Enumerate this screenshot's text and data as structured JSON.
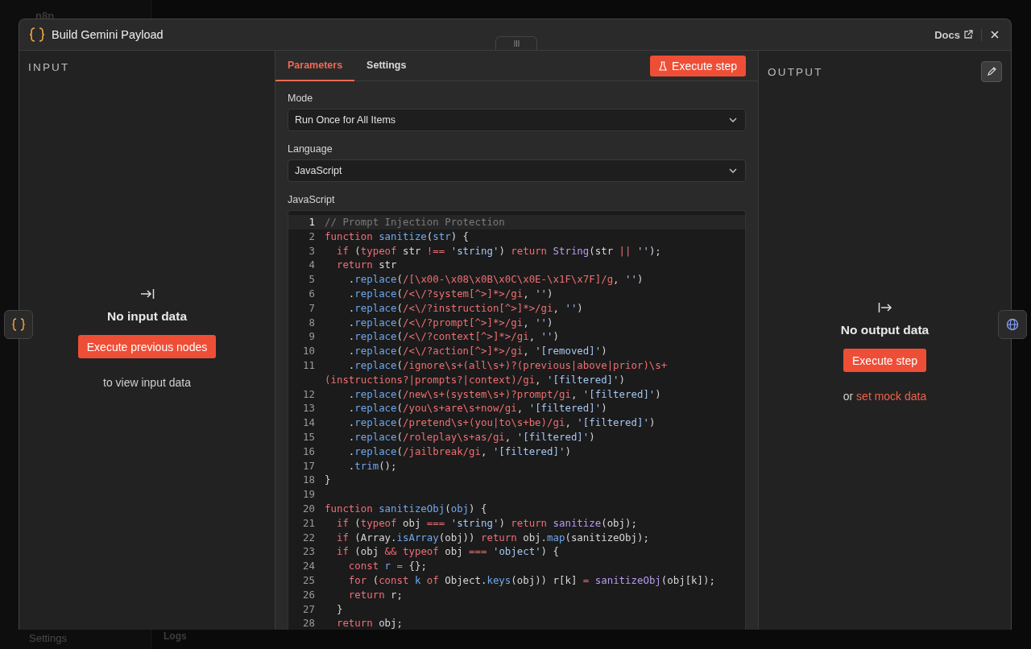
{
  "backdrop": {
    "brand": "n8n",
    "sidebar_item": "Settings",
    "bottom_tab": "Logs"
  },
  "modal": {
    "title": "Build Gemini Payload",
    "docs_link": "Docs"
  },
  "input_panel": {
    "heading": "INPUT",
    "empty_title": "No input data",
    "button": "Execute previous nodes",
    "hint": "to view input data"
  },
  "tabs": [
    {
      "label": "Parameters",
      "selected": true
    },
    {
      "label": "Settings",
      "selected": false
    }
  ],
  "execute_button": "Execute step",
  "fields": [
    {
      "label": "Mode",
      "value": "Run Once for All Items"
    },
    {
      "label": "Language",
      "value": "JavaScript"
    }
  ],
  "code": {
    "label": "JavaScript",
    "lines": [
      {
        "number": "1",
        "active": true,
        "tokens": [
          {
            "kind": "cm",
            "text": "// Prompt Injection Protection"
          }
        ]
      },
      {
        "number": "2",
        "active": false,
        "tokens": [
          {
            "kind": "kw",
            "text": "function "
          },
          {
            "kind": "fn",
            "text": "sanitize"
          },
          {
            "kind": "tx",
            "text": "("
          },
          {
            "kind": "var",
            "text": "str"
          },
          {
            "kind": "tx",
            "text": ") {"
          }
        ]
      },
      {
        "number": "3",
        "active": false,
        "tokens": [
          {
            "kind": "kw",
            "text": "  if"
          },
          {
            "kind": "tx",
            "text": " ("
          },
          {
            "kind": "kw",
            "text": "typeof"
          },
          {
            "kind": "tx",
            "text": " str "
          },
          {
            "kind": "op",
            "text": "!== "
          },
          {
            "kind": "str",
            "text": "'string'"
          },
          {
            "kind": "tx",
            "text": ") "
          },
          {
            "kind": "kw",
            "text": "return "
          },
          {
            "kind": "call",
            "text": "String"
          },
          {
            "kind": "tx",
            "text": "(str "
          },
          {
            "kind": "op",
            "text": "|| "
          },
          {
            "kind": "str",
            "text": "''"
          },
          {
            "kind": "tx",
            "text": ");"
          }
        ]
      },
      {
        "number": "4",
        "active": false,
        "tokens": [
          {
            "kind": "kw",
            "text": "  return"
          },
          {
            "kind": "tx",
            "text": " str"
          }
        ]
      },
      {
        "number": "5",
        "active": false,
        "tokens": [
          {
            "kind": "tx",
            "text": "    ."
          },
          {
            "kind": "method",
            "text": "replace"
          },
          {
            "kind": "tx",
            "text": "("
          },
          {
            "kind": "re",
            "text": "/[\\x00-\\x08\\x0B\\x0C\\x0E-\\x1F\\x7F]/g"
          },
          {
            "kind": "tx",
            "text": ", "
          },
          {
            "kind": "str",
            "text": "''"
          },
          {
            "kind": "tx",
            "text": ")"
          }
        ]
      },
      {
        "number": "6",
        "active": false,
        "tokens": [
          {
            "kind": "tx",
            "text": "    ."
          },
          {
            "kind": "method",
            "text": "replace"
          },
          {
            "kind": "tx",
            "text": "("
          },
          {
            "kind": "re",
            "text": "/<\\/?system[^>]*>/gi"
          },
          {
            "kind": "tx",
            "text": ", "
          },
          {
            "kind": "str",
            "text": "''"
          },
          {
            "kind": "tx",
            "text": ")"
          }
        ]
      },
      {
        "number": "7",
        "active": false,
        "tokens": [
          {
            "kind": "tx",
            "text": "    ."
          },
          {
            "kind": "method",
            "text": "replace"
          },
          {
            "kind": "tx",
            "text": "("
          },
          {
            "kind": "re",
            "text": "/<\\/?instruction[^>]*>/gi"
          },
          {
            "kind": "tx",
            "text": ", "
          },
          {
            "kind": "str",
            "text": "''"
          },
          {
            "kind": "tx",
            "text": ")"
          }
        ]
      },
      {
        "number": "8",
        "active": false,
        "tokens": [
          {
            "kind": "tx",
            "text": "    ."
          },
          {
            "kind": "method",
            "text": "replace"
          },
          {
            "kind": "tx",
            "text": "("
          },
          {
            "kind": "re",
            "text": "/<\\/?prompt[^>]*>/gi"
          },
          {
            "kind": "tx",
            "text": ", "
          },
          {
            "kind": "str",
            "text": "''"
          },
          {
            "kind": "tx",
            "text": ")"
          }
        ]
      },
      {
        "number": "9",
        "active": false,
        "tokens": [
          {
            "kind": "tx",
            "text": "    ."
          },
          {
            "kind": "method",
            "text": "replace"
          },
          {
            "kind": "tx",
            "text": "("
          },
          {
            "kind": "re",
            "text": "/<\\/?context[^>]*>/gi"
          },
          {
            "kind": "tx",
            "text": ", "
          },
          {
            "kind": "str",
            "text": "''"
          },
          {
            "kind": "tx",
            "text": ")"
          }
        ]
      },
      {
        "number": "10",
        "active": false,
        "tokens": [
          {
            "kind": "tx",
            "text": "    ."
          },
          {
            "kind": "method",
            "text": "replace"
          },
          {
            "kind": "tx",
            "text": "("
          },
          {
            "kind": "re",
            "text": "/<\\/?action[^>]*>/gi"
          },
          {
            "kind": "tx",
            "text": ", "
          },
          {
            "kind": "str",
            "text": "'[removed]'"
          },
          {
            "kind": "tx",
            "text": ")"
          }
        ]
      },
      {
        "number": "11",
        "active": false,
        "tokens": [
          {
            "kind": "tx",
            "text": "    ."
          },
          {
            "kind": "method",
            "text": "replace"
          },
          {
            "kind": "tx",
            "text": "("
          },
          {
            "kind": "re",
            "text": "/ignore\\s+(all\\s+)?(previous|above|prior)\\s+"
          }
        ],
        "wrapped_tokens": [
          {
            "kind": "re",
            "text": "(instructions?|prompts?|context)/gi"
          },
          {
            "kind": "tx",
            "text": ", "
          },
          {
            "kind": "str",
            "text": "'[filtered]'"
          },
          {
            "kind": "tx",
            "text": ")"
          }
        ]
      },
      {
        "number": "12",
        "active": false,
        "tokens": [
          {
            "kind": "tx",
            "text": "    ."
          },
          {
            "kind": "method",
            "text": "replace"
          },
          {
            "kind": "tx",
            "text": "("
          },
          {
            "kind": "re",
            "text": "/new\\s+(system\\s+)?prompt/gi"
          },
          {
            "kind": "tx",
            "text": ", "
          },
          {
            "kind": "str",
            "text": "'[filtered]'"
          },
          {
            "kind": "tx",
            "text": ")"
          }
        ]
      },
      {
        "number": "13",
        "active": false,
        "tokens": [
          {
            "kind": "tx",
            "text": "    ."
          },
          {
            "kind": "method",
            "text": "replace"
          },
          {
            "kind": "tx",
            "text": "("
          },
          {
            "kind": "re",
            "text": "/you\\s+are\\s+now/gi"
          },
          {
            "kind": "tx",
            "text": ", "
          },
          {
            "kind": "str",
            "text": "'[filtered]'"
          },
          {
            "kind": "tx",
            "text": ")"
          }
        ]
      },
      {
        "number": "14",
        "active": false,
        "tokens": [
          {
            "kind": "tx",
            "text": "    ."
          },
          {
            "kind": "method",
            "text": "replace"
          },
          {
            "kind": "tx",
            "text": "("
          },
          {
            "kind": "re",
            "text": "/pretend\\s+(you|to\\s+be)/gi"
          },
          {
            "kind": "tx",
            "text": ", "
          },
          {
            "kind": "str",
            "text": "'[filtered]'"
          },
          {
            "kind": "tx",
            "text": ")"
          }
        ]
      },
      {
        "number": "15",
        "active": false,
        "tokens": [
          {
            "kind": "tx",
            "text": "    ."
          },
          {
            "kind": "method",
            "text": "replace"
          },
          {
            "kind": "tx",
            "text": "("
          },
          {
            "kind": "re",
            "text": "/roleplay\\s+as/gi"
          },
          {
            "kind": "tx",
            "text": ", "
          },
          {
            "kind": "str",
            "text": "'[filtered]'"
          },
          {
            "kind": "tx",
            "text": ")"
          }
        ]
      },
      {
        "number": "16",
        "active": false,
        "tokens": [
          {
            "kind": "tx",
            "text": "    ."
          },
          {
            "kind": "method",
            "text": "replace"
          },
          {
            "kind": "tx",
            "text": "("
          },
          {
            "kind": "re",
            "text": "/jailbreak/gi"
          },
          {
            "kind": "tx",
            "text": ", "
          },
          {
            "kind": "str",
            "text": "'[filtered]'"
          },
          {
            "kind": "tx",
            "text": ")"
          }
        ]
      },
      {
        "number": "17",
        "active": false,
        "tokens": [
          {
            "kind": "tx",
            "text": "    ."
          },
          {
            "kind": "method",
            "text": "trim"
          },
          {
            "kind": "tx",
            "text": "();"
          }
        ]
      },
      {
        "number": "18",
        "active": false,
        "tokens": [
          {
            "kind": "tx",
            "text": "}"
          }
        ]
      },
      {
        "number": "19",
        "active": false
      },
      {
        "number": "20",
        "active": false,
        "tokens": [
          {
            "kind": "kw",
            "text": "function "
          },
          {
            "kind": "fn",
            "text": "sanitizeObj"
          },
          {
            "kind": "tx",
            "text": "("
          },
          {
            "kind": "var",
            "text": "obj"
          },
          {
            "kind": "tx",
            "text": ") {"
          }
        ]
      },
      {
        "number": "21",
        "active": false,
        "tokens": [
          {
            "kind": "kw",
            "text": "  if"
          },
          {
            "kind": "tx",
            "text": " ("
          },
          {
            "kind": "kw",
            "text": "typeof"
          },
          {
            "kind": "tx",
            "text": " obj "
          },
          {
            "kind": "op",
            "text": "=== "
          },
          {
            "kind": "str",
            "text": "'string'"
          },
          {
            "kind": "tx",
            "text": ") "
          },
          {
            "kind": "kw",
            "text": "return "
          },
          {
            "kind": "call",
            "text": "sanitize"
          },
          {
            "kind": "tx",
            "text": "(obj);"
          }
        ]
      },
      {
        "number": "22",
        "active": false,
        "tokens": [
          {
            "kind": "kw",
            "text": "  if"
          },
          {
            "kind": "tx",
            "text": " (Array."
          },
          {
            "kind": "method",
            "text": "isArray"
          },
          {
            "kind": "tx",
            "text": "(obj)) "
          },
          {
            "kind": "kw",
            "text": "return"
          },
          {
            "kind": "tx",
            "text": " obj."
          },
          {
            "kind": "method",
            "text": "map"
          },
          {
            "kind": "tx",
            "text": "(sanitizeObj);"
          }
        ]
      },
      {
        "number": "23",
        "active": false,
        "tokens": [
          {
            "kind": "kw",
            "text": "  if"
          },
          {
            "kind": "tx",
            "text": " (obj "
          },
          {
            "kind": "op",
            "text": "&& "
          },
          {
            "kind": "kw",
            "text": "typeof"
          },
          {
            "kind": "tx",
            "text": " obj "
          },
          {
            "kind": "op",
            "text": "=== "
          },
          {
            "kind": "str",
            "text": "'object'"
          },
          {
            "kind": "tx",
            "text": ") {"
          }
        ]
      },
      {
        "number": "24",
        "active": false,
        "tokens": [
          {
            "kind": "kw",
            "text": "    const "
          },
          {
            "kind": "var",
            "text": "r"
          },
          {
            "kind": "op",
            "text": " ="
          },
          {
            "kind": "tx",
            "text": " {};"
          }
        ]
      },
      {
        "number": "25",
        "active": false,
        "tokens": [
          {
            "kind": "kw",
            "text": "    for"
          },
          {
            "kind": "tx",
            "text": " ("
          },
          {
            "kind": "kw",
            "text": "const "
          },
          {
            "kind": "var",
            "text": "k"
          },
          {
            "kind": "kw",
            "text": " of"
          },
          {
            "kind": "tx",
            "text": " Object."
          },
          {
            "kind": "method",
            "text": "keys"
          },
          {
            "kind": "tx",
            "text": "(obj)) r[k] "
          },
          {
            "kind": "op",
            "text": "= "
          },
          {
            "kind": "call",
            "text": "sanitizeObj"
          },
          {
            "kind": "tx",
            "text": "(obj[k]);"
          }
        ]
      },
      {
        "number": "26",
        "active": false,
        "tokens": [
          {
            "kind": "kw",
            "text": "    return"
          },
          {
            "kind": "tx",
            "text": " r;"
          }
        ]
      },
      {
        "number": "27",
        "active": false,
        "tokens": [
          {
            "kind": "tx",
            "text": "  }"
          }
        ]
      },
      {
        "number": "28",
        "active": false,
        "tokens": [
          {
            "kind": "kw",
            "text": "  return"
          },
          {
            "kind": "tx",
            "text": " obj;"
          }
        ]
      }
    ]
  },
  "output_panel": {
    "heading": "OUTPUT",
    "empty_title": "No output data",
    "button": "Execute step",
    "hint_prefix": "or",
    "hint_link": "set mock data"
  }
}
